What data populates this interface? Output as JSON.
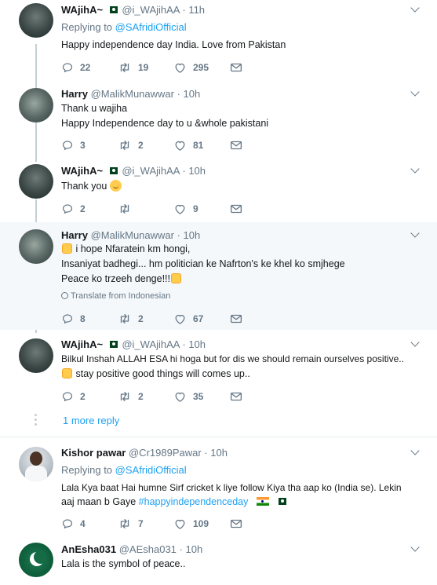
{
  "tweets": [
    {
      "name": "WAjihA~",
      "handle": "@i_WAjihAA",
      "time": "· 11h",
      "replying_prefix": "Replying to ",
      "replying_handle": "@SAfridiOfficial",
      "text": "Happy independence day India. Love from Pakistan",
      "replies": "22",
      "retweets": "19",
      "likes": "295"
    },
    {
      "name": "Harry",
      "handle": "@MalikMunawwar",
      "time": "· 10h",
      "lines": [
        "Thank u wajiha",
        "Happy Independence day to u &whole pakistani"
      ],
      "replies": "3",
      "retweets": "2",
      "likes": "81"
    },
    {
      "name": "WAjihA~",
      "handle": "@i_WAjihAA",
      "time": "· 10h",
      "text": "Thank you",
      "replies": "2",
      "retweets": "",
      "likes": "9"
    },
    {
      "name": "Harry",
      "handle": "@MalikMunawwar",
      "time": "· 10h",
      "lines": [
        "i hope Nfaratein km hongi,",
        "Insaniyat badhegi... hm politician ke Nafrton's ke khel ko smjhege",
        "Peace ko trzeeh denge!!!"
      ],
      "translate": "Translate from Indonesian",
      "replies": "8",
      "retweets": "2",
      "likes": "67"
    },
    {
      "name": "WAjihA~",
      "handle": "@i_WAjihAA",
      "time": "· 10h",
      "lines": [
        "Bilkul Inshah ALLAH ESA hi hoga but for dis  we should remain ourselves positive..",
        "stay positive good things will comes up.."
      ],
      "replies": "2",
      "retweets": "2",
      "likes": "35"
    },
    {
      "name": "Kishor pawar",
      "handle": "@Cr1989Pawar",
      "time": "· 10h",
      "replying_prefix": "Replying to ",
      "replying_handle": "@SAfridiOfficial",
      "lines": [
        "Lala Kya baat Hai humne Sirf  cricket k liye follow Kiya tha aap ko (India se). Lekin",
        "aaj maan b Gaye "
      ],
      "hashtag": "#happyindependenceday",
      "replies": "4",
      "retweets": "7",
      "likes": "109"
    },
    {
      "name": "AnEsha031",
      "handle": "@AEsha031",
      "time": "· 10h",
      "text": "Lala is the symbol of peace.."
    }
  ],
  "more_reply": "1 more reply",
  "icons": [
    "reply-icon",
    "retweet-icon",
    "like-icon",
    "message-icon",
    "caret-down-icon",
    "globe-icon"
  ],
  "colors": {
    "link": "#1da1f2",
    "muted": "#657786",
    "highlight_bg": "#f5f8fa",
    "thread_line": "#c4cfd6"
  }
}
